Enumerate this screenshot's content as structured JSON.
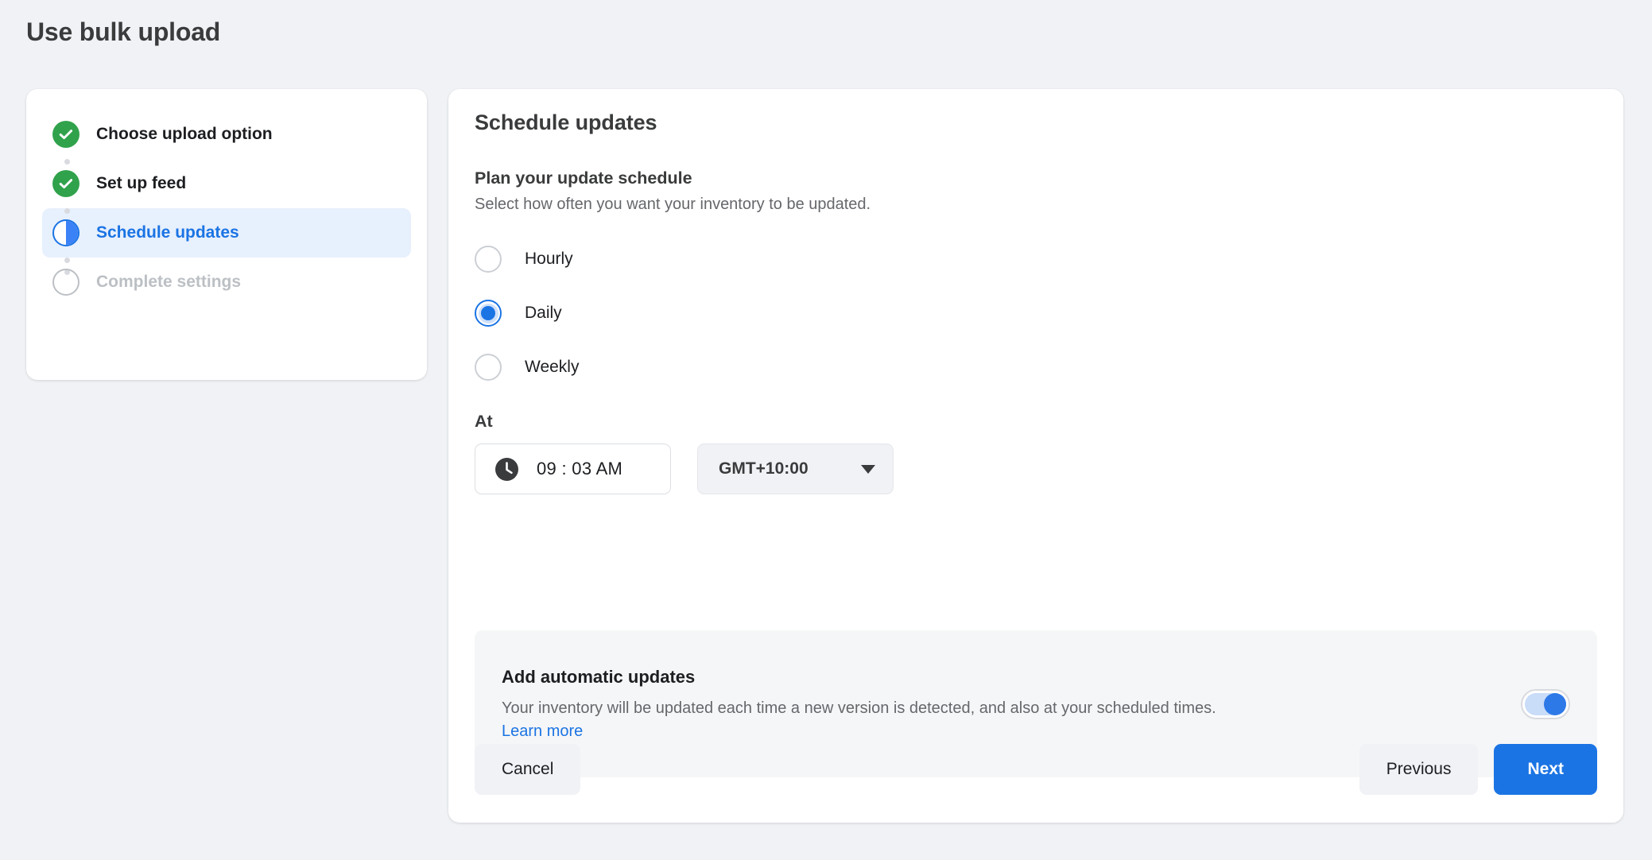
{
  "page": {
    "title": "Use bulk upload",
    "background_color": "#f0f2f5"
  },
  "stepper": {
    "steps": [
      {
        "label": "Choose upload option",
        "state": "done",
        "icon": "check-circle-icon"
      },
      {
        "label": "Set up feed",
        "state": "done",
        "icon": "check-circle-icon"
      },
      {
        "label": "Schedule updates",
        "state": "active",
        "icon": "half-circle-icon"
      },
      {
        "label": "Complete settings",
        "state": "pending",
        "icon": "empty-circle-icon"
      }
    ],
    "colors": {
      "done": "#31a24c",
      "active": "#1b74e4",
      "pending": "#bcc0c4",
      "active_row_background": "#e7f0fd"
    }
  },
  "panel": {
    "title": "Schedule updates",
    "section_heading": "Plan your update schedule",
    "section_subtext": "Select how often you want your inventory to be updated.",
    "frequency": {
      "selected": "Daily",
      "options": [
        {
          "label": "Hourly",
          "checked": false
        },
        {
          "label": "Daily",
          "checked": true
        },
        {
          "label": "Weekly",
          "checked": false
        }
      ]
    },
    "at": {
      "label": "At",
      "time_value": "09 : 03 AM",
      "time_icon": "clock-icon",
      "timezone_value": "GMT+10:00",
      "timezone_caret_icon": "chevron-down-icon"
    },
    "automatic_updates": {
      "title": "Add automatic updates",
      "description": "Your inventory will be updated each time a new version is detected, and also at your scheduled times.",
      "link_label": "Learn more",
      "toggle_state": "on",
      "toggle_color": "#2e79e8"
    }
  },
  "footer": {
    "cancel_label": "Cancel",
    "previous_label": "Previous",
    "next_label": "Next",
    "primary_color": "#1b74e4"
  }
}
